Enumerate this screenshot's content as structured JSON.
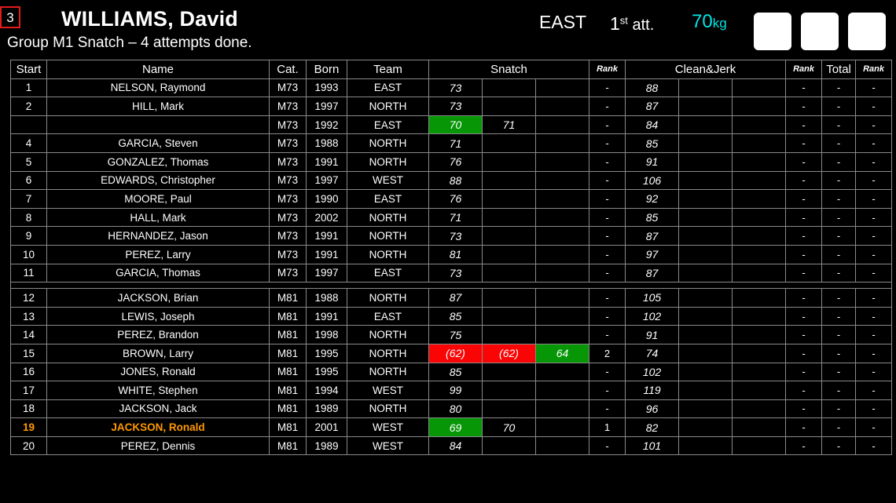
{
  "header": {
    "lot_number": "3",
    "athlete_name": "WILLIAMS, David",
    "subtitle": "Group M1 Snatch – 4 attempts done.",
    "team": "EAST",
    "attempt_num": "1",
    "attempt_ord": "st",
    "attempt_word": "att.",
    "weight": "70",
    "weight_unit": "kg",
    "lights": [
      "white",
      "white",
      "white"
    ],
    "accent_lot_border": "#e21b1b",
    "accent_weight": "#00e5e5"
  },
  "table": {
    "columns": {
      "start": "Start",
      "name": "Name",
      "cat": "Cat.",
      "born": "Born",
      "team": "Team",
      "snatch": "Snatch",
      "snatch_rank": "Rank",
      "cleanjerk": "Clean&Jerk",
      "cleanjerk_rank": "Rank",
      "total": "Total",
      "total_rank": "Rank"
    },
    "groups": [
      {
        "category": "M73",
        "rows": [
          {
            "start": "1",
            "name": "NELSON, Raymond",
            "cat": "M73",
            "born": "1993",
            "team": "EAST",
            "sn": [
              {
                "v": "73",
                "s": "plain"
              },
              {
                "v": "",
                "s": "empty"
              },
              {
                "v": "",
                "s": "empty"
              }
            ],
            "sn_rank": "-",
            "cj": [
              {
                "v": "88",
                "s": "plain"
              },
              {
                "v": "",
                "s": "empty"
              },
              {
                "v": "",
                "s": "empty"
              }
            ],
            "cj_rank": "-",
            "total": "-",
            "total_rank": "-",
            "highlight": false
          },
          {
            "start": "2",
            "name": "HILL, Mark",
            "cat": "M73",
            "born": "1997",
            "team": "NORTH",
            "sn": [
              {
                "v": "73",
                "s": "plain"
              },
              {
                "v": "",
                "s": "empty"
              },
              {
                "v": "",
                "s": "empty"
              }
            ],
            "sn_rank": "-",
            "cj": [
              {
                "v": "87",
                "s": "plain"
              },
              {
                "v": "",
                "s": "empty"
              },
              {
                "v": "",
                "s": "empty"
              }
            ],
            "cj_rank": "-",
            "total": "-",
            "total_rank": "-",
            "highlight": false
          },
          {
            "start": "",
            "name": "",
            "cat": "M73",
            "born": "1992",
            "team": "EAST",
            "sn": [
              {
                "v": "70",
                "s": "good"
              },
              {
                "v": "71",
                "s": "next-yellow"
              },
              {
                "v": "",
                "s": "empty"
              }
            ],
            "sn_rank": "-",
            "cj": [
              {
                "v": "84",
                "s": "plain"
              },
              {
                "v": "",
                "s": "empty"
              },
              {
                "v": "",
                "s": "empty"
              }
            ],
            "cj_rank": "-",
            "total": "-",
            "total_rank": "-",
            "highlight": false
          },
          {
            "start": "4",
            "name": "GARCIA, Steven",
            "cat": "M73",
            "born": "1988",
            "team": "NORTH",
            "sn": [
              {
                "v": "71",
                "s": "plain"
              },
              {
                "v": "",
                "s": "empty"
              },
              {
                "v": "",
                "s": "empty"
              }
            ],
            "sn_rank": "-",
            "cj": [
              {
                "v": "85",
                "s": "plain"
              },
              {
                "v": "",
                "s": "empty"
              },
              {
                "v": "",
                "s": "empty"
              }
            ],
            "cj_rank": "-",
            "total": "-",
            "total_rank": "-",
            "highlight": false
          },
          {
            "start": "5",
            "name": "GONZALEZ, Thomas",
            "cat": "M73",
            "born": "1991",
            "team": "NORTH",
            "sn": [
              {
                "v": "76",
                "s": "plain"
              },
              {
                "v": "",
                "s": "empty"
              },
              {
                "v": "",
                "s": "empty"
              }
            ],
            "sn_rank": "-",
            "cj": [
              {
                "v": "91",
                "s": "plain"
              },
              {
                "v": "",
                "s": "empty"
              },
              {
                "v": "",
                "s": "empty"
              }
            ],
            "cj_rank": "-",
            "total": "-",
            "total_rank": "-",
            "highlight": false
          },
          {
            "start": "6",
            "name": "EDWARDS, Christopher",
            "cat": "M73",
            "born": "1997",
            "team": "WEST",
            "sn": [
              {
                "v": "88",
                "s": "plain"
              },
              {
                "v": "",
                "s": "empty"
              },
              {
                "v": "",
                "s": "empty"
              }
            ],
            "sn_rank": "-",
            "cj": [
              {
                "v": "106",
                "s": "plain"
              },
              {
                "v": "",
                "s": "empty"
              },
              {
                "v": "",
                "s": "empty"
              }
            ],
            "cj_rank": "-",
            "total": "-",
            "total_rank": "-",
            "highlight": false
          },
          {
            "start": "7",
            "name": "MOORE, Paul",
            "cat": "M73",
            "born": "1990",
            "team": "EAST",
            "sn": [
              {
                "v": "76",
                "s": "plain"
              },
              {
                "v": "",
                "s": "empty"
              },
              {
                "v": "",
                "s": "empty"
              }
            ],
            "sn_rank": "-",
            "cj": [
              {
                "v": "92",
                "s": "plain"
              },
              {
                "v": "",
                "s": "empty"
              },
              {
                "v": "",
                "s": "empty"
              }
            ],
            "cj_rank": "-",
            "total": "-",
            "total_rank": "-",
            "highlight": false
          },
          {
            "start": "8",
            "name": "HALL, Mark",
            "cat": "M73",
            "born": "2002",
            "team": "NORTH",
            "sn": [
              {
                "v": "71",
                "s": "plain"
              },
              {
                "v": "",
                "s": "empty"
              },
              {
                "v": "",
                "s": "empty"
              }
            ],
            "sn_rank": "-",
            "cj": [
              {
                "v": "85",
                "s": "plain"
              },
              {
                "v": "",
                "s": "empty"
              },
              {
                "v": "",
                "s": "empty"
              }
            ],
            "cj_rank": "-",
            "total": "-",
            "total_rank": "-",
            "highlight": false
          },
          {
            "start": "9",
            "name": "HERNANDEZ, Jason",
            "cat": "M73",
            "born": "1991",
            "team": "NORTH",
            "sn": [
              {
                "v": "73",
                "s": "plain"
              },
              {
                "v": "",
                "s": "empty"
              },
              {
                "v": "",
                "s": "empty"
              }
            ],
            "sn_rank": "-",
            "cj": [
              {
                "v": "87",
                "s": "plain"
              },
              {
                "v": "",
                "s": "empty"
              },
              {
                "v": "",
                "s": "empty"
              }
            ],
            "cj_rank": "-",
            "total": "-",
            "total_rank": "-",
            "highlight": false
          },
          {
            "start": "10",
            "name": "PEREZ, Larry",
            "cat": "M73",
            "born": "1991",
            "team": "NORTH",
            "sn": [
              {
                "v": "81",
                "s": "plain"
              },
              {
                "v": "",
                "s": "empty"
              },
              {
                "v": "",
                "s": "empty"
              }
            ],
            "sn_rank": "-",
            "cj": [
              {
                "v": "97",
                "s": "plain"
              },
              {
                "v": "",
                "s": "empty"
              },
              {
                "v": "",
                "s": "empty"
              }
            ],
            "cj_rank": "-",
            "total": "-",
            "total_rank": "-",
            "highlight": false
          },
          {
            "start": "11",
            "name": "GARCIA, Thomas",
            "cat": "M73",
            "born": "1997",
            "team": "EAST",
            "sn": [
              {
                "v": "73",
                "s": "plain"
              },
              {
                "v": "",
                "s": "empty"
              },
              {
                "v": "",
                "s": "empty"
              }
            ],
            "sn_rank": "-",
            "cj": [
              {
                "v": "87",
                "s": "plain"
              },
              {
                "v": "",
                "s": "empty"
              },
              {
                "v": "",
                "s": "empty"
              }
            ],
            "cj_rank": "-",
            "total": "-",
            "total_rank": "-",
            "highlight": false
          }
        ]
      },
      {
        "category": "M81",
        "rows": [
          {
            "start": "12",
            "name": "JACKSON, Brian",
            "cat": "M81",
            "born": "1988",
            "team": "NORTH",
            "sn": [
              {
                "v": "87",
                "s": "plain"
              },
              {
                "v": "",
                "s": "empty"
              },
              {
                "v": "",
                "s": "empty"
              }
            ],
            "sn_rank": "-",
            "cj": [
              {
                "v": "105",
                "s": "plain"
              },
              {
                "v": "",
                "s": "empty"
              },
              {
                "v": "",
                "s": "empty"
              }
            ],
            "cj_rank": "-",
            "total": "-",
            "total_rank": "-",
            "highlight": false
          },
          {
            "start": "13",
            "name": "LEWIS, Joseph",
            "cat": "M81",
            "born": "1991",
            "team": "EAST",
            "sn": [
              {
                "v": "85",
                "s": "plain"
              },
              {
                "v": "",
                "s": "empty"
              },
              {
                "v": "",
                "s": "empty"
              }
            ],
            "sn_rank": "-",
            "cj": [
              {
                "v": "102",
                "s": "plain"
              },
              {
                "v": "",
                "s": "empty"
              },
              {
                "v": "",
                "s": "empty"
              }
            ],
            "cj_rank": "-",
            "total": "-",
            "total_rank": "-",
            "highlight": false
          },
          {
            "start": "14",
            "name": "PEREZ, Brandon",
            "cat": "M81",
            "born": "1998",
            "team": "NORTH",
            "sn": [
              {
                "v": "75",
                "s": "plain"
              },
              {
                "v": "",
                "s": "empty"
              },
              {
                "v": "",
                "s": "empty"
              }
            ],
            "sn_rank": "-",
            "cj": [
              {
                "v": "91",
                "s": "plain"
              },
              {
                "v": "",
                "s": "empty"
              },
              {
                "v": "",
                "s": "empty"
              }
            ],
            "cj_rank": "-",
            "total": "-",
            "total_rank": "-",
            "highlight": false
          },
          {
            "start": "15",
            "name": "BROWN, Larry",
            "cat": "M81",
            "born": "1995",
            "team": "NORTH",
            "sn": [
              {
                "v": "(62)",
                "s": "fail"
              },
              {
                "v": "(62)",
                "s": "fail"
              },
              {
                "v": "64",
                "s": "good"
              }
            ],
            "sn_rank": "2",
            "cj": [
              {
                "v": "74",
                "s": "plain"
              },
              {
                "v": "",
                "s": "empty"
              },
              {
                "v": "",
                "s": "empty"
              }
            ],
            "cj_rank": "-",
            "total": "-",
            "total_rank": "-",
            "highlight": false
          },
          {
            "start": "16",
            "name": "JONES, Ronald",
            "cat": "M81",
            "born": "1995",
            "team": "NORTH",
            "sn": [
              {
                "v": "85",
                "s": "plain"
              },
              {
                "v": "",
                "s": "empty"
              },
              {
                "v": "",
                "s": "empty"
              }
            ],
            "sn_rank": "-",
            "cj": [
              {
                "v": "102",
                "s": "plain"
              },
              {
                "v": "",
                "s": "empty"
              },
              {
                "v": "",
                "s": "empty"
              }
            ],
            "cj_rank": "-",
            "total": "-",
            "total_rank": "-",
            "highlight": false
          },
          {
            "start": "17",
            "name": "WHITE, Stephen",
            "cat": "M81",
            "born": "1994",
            "team": "WEST",
            "sn": [
              {
                "v": "99",
                "s": "plain"
              },
              {
                "v": "",
                "s": "empty"
              },
              {
                "v": "",
                "s": "empty"
              }
            ],
            "sn_rank": "-",
            "cj": [
              {
                "v": "119",
                "s": "plain"
              },
              {
                "v": "",
                "s": "empty"
              },
              {
                "v": "",
                "s": "empty"
              }
            ],
            "cj_rank": "-",
            "total": "-",
            "total_rank": "-",
            "highlight": false
          },
          {
            "start": "18",
            "name": "JACKSON, Jack",
            "cat": "M81",
            "born": "1989",
            "team": "NORTH",
            "sn": [
              {
                "v": "80",
                "s": "plain"
              },
              {
                "v": "",
                "s": "empty"
              },
              {
                "v": "",
                "s": "empty"
              }
            ],
            "sn_rank": "-",
            "cj": [
              {
                "v": "96",
                "s": "plain"
              },
              {
                "v": "",
                "s": "empty"
              },
              {
                "v": "",
                "s": "empty"
              }
            ],
            "cj_rank": "-",
            "total": "-",
            "total_rank": "-",
            "highlight": false
          },
          {
            "start": "19",
            "name": "JACKSON, Ronald",
            "cat": "M81",
            "born": "2001",
            "team": "WEST",
            "sn": [
              {
                "v": "69",
                "s": "good"
              },
              {
                "v": "70",
                "s": "next-orange"
              },
              {
                "v": "",
                "s": "empty"
              }
            ],
            "sn_rank": "1",
            "cj": [
              {
                "v": "82",
                "s": "plain"
              },
              {
                "v": "",
                "s": "empty"
              },
              {
                "v": "",
                "s": "empty"
              }
            ],
            "cj_rank": "-",
            "total": "-",
            "total_rank": "-",
            "highlight": true
          },
          {
            "start": "20",
            "name": "PEREZ, Dennis",
            "cat": "M81",
            "born": "1989",
            "team": "WEST",
            "sn": [
              {
                "v": "84",
                "s": "plain"
              },
              {
                "v": "",
                "s": "empty"
              },
              {
                "v": "",
                "s": "empty"
              }
            ],
            "sn_rank": "-",
            "cj": [
              {
                "v": "101",
                "s": "plain"
              },
              {
                "v": "",
                "s": "empty"
              },
              {
                "v": "",
                "s": "empty"
              }
            ],
            "cj_rank": "-",
            "total": "-",
            "total_rank": "-",
            "highlight": false
          }
        ]
      }
    ]
  }
}
